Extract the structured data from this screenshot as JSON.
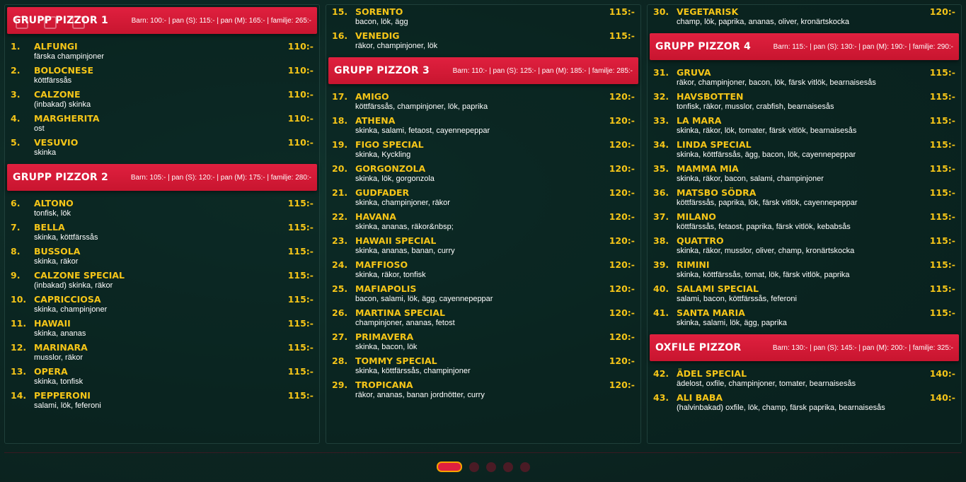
{
  "columns": [
    [
      {
        "type": "header",
        "title": "GRUPP PIZZOR 1",
        "prices": "Barn: 100:- | pan (S): 115:- | pan (M): 165:- | familje: 265:-"
      },
      {
        "type": "item",
        "num": "1.",
        "name": "ALFUNGI",
        "desc": "färska champinjoner",
        "price": "110:-"
      },
      {
        "type": "item",
        "num": "2.",
        "name": "BOLOCNESE",
        "desc": "köttfärssås",
        "price": "110:-"
      },
      {
        "type": "item",
        "num": "3.",
        "name": "CALZONE",
        "desc": "(inbakad) skinka",
        "price": "110:-"
      },
      {
        "type": "item",
        "num": "4.",
        "name": "MARGHERITA",
        "desc": "ost",
        "price": "110:-"
      },
      {
        "type": "item",
        "num": "5.",
        "name": "VESUVIO",
        "desc": "skinka",
        "price": "110:-"
      },
      {
        "type": "header",
        "title": "GRUPP PIZZOR 2",
        "prices": "Barn: 105:- | pan (S): 120:- | pan (M): 175:- | familje: 280:-"
      },
      {
        "type": "item",
        "num": "6.",
        "name": "ALTONO",
        "desc": "tonfisk, lök",
        "price": "115:-"
      },
      {
        "type": "item",
        "num": "7.",
        "name": "BELLA",
        "desc": "skinka, köttfärssås",
        "price": "115:-"
      },
      {
        "type": "item",
        "num": "8.",
        "name": "BUSSOLA",
        "desc": "skinka, räkor",
        "price": "115:-"
      },
      {
        "type": "item",
        "num": "9.",
        "name": "CALZONE SPECIAL",
        "desc": "(inbakad) skinka, räkor",
        "price": "115:-"
      },
      {
        "type": "item",
        "num": "10.",
        "name": "CAPRICCIOSA",
        "desc": "skinka, champinjoner",
        "price": "115:-"
      },
      {
        "type": "item",
        "num": "11.",
        "name": "HAWAII",
        "desc": "skinka, ananas",
        "price": "115:-"
      },
      {
        "type": "item",
        "num": "12.",
        "name": "MARINARA",
        "desc": "musslor, räkor",
        "price": "115:-"
      },
      {
        "type": "item",
        "num": "13.",
        "name": "OPERA",
        "desc": "skinka, tonfisk",
        "price": "115:-"
      },
      {
        "type": "item",
        "num": "14.",
        "name": "PEPPERONI",
        "desc": "salami, lök, feferoni",
        "price": "115:-"
      }
    ],
    [
      {
        "type": "item",
        "num": "15.",
        "name": "SORENTO",
        "desc": "bacon, lök, ägg",
        "price": "115:-"
      },
      {
        "type": "item",
        "num": "16.",
        "name": "VENEDIG",
        "desc": "räkor, champinjoner, lök",
        "price": "115:-"
      },
      {
        "type": "header",
        "title": "GRUPP PIZZOR 3",
        "prices": "Barn: 110:- | pan (S): 125:- | pan (M): 185:- | familje: 285:-"
      },
      {
        "type": "item",
        "num": "17.",
        "name": "AMIGO",
        "desc": "köttfärssås, champinjoner, lök, paprika",
        "price": "120:-"
      },
      {
        "type": "item",
        "num": "18.",
        "name": "ATHENA",
        "desc": "skinka, salami, fetaost, cayennepeppar",
        "price": "120:-"
      },
      {
        "type": "item",
        "num": "19.",
        "name": "FIGO SPECIAL",
        "desc": "skinka, Kyckling",
        "price": "120:-"
      },
      {
        "type": "item",
        "num": "20.",
        "name": "GORGONZOLA",
        "desc": "skinka, lök, gorgonzola",
        "price": "120:-"
      },
      {
        "type": "item",
        "num": "21.",
        "name": "GUDFADER",
        "desc": "skinka, champinjoner, räkor",
        "price": "120:-"
      },
      {
        "type": "item",
        "num": "22.",
        "name": "HAVANA",
        "desc": "skinka, ananas, räkor&nbsp;",
        "price": "120:-"
      },
      {
        "type": "item",
        "num": "23.",
        "name": "HAWAII SPECIAL",
        "desc": "skinka, ananas, banan, curry",
        "price": "120:-"
      },
      {
        "type": "item",
        "num": "24.",
        "name": "MAFFIOSO",
        "desc": "skinka, räkor, tonfisk",
        "price": "120:-"
      },
      {
        "type": "item",
        "num": "25.",
        "name": "MAFIAPOLIS",
        "desc": "bacon, salami, lök, ägg, cayennepeppar",
        "price": "120:-"
      },
      {
        "type": "item",
        "num": "26.",
        "name": "MARTINA SPECIAL",
        "desc": "champinjoner, ananas, fetost",
        "price": "120:-"
      },
      {
        "type": "item",
        "num": "27.",
        "name": "PRIMAVERA",
        "desc": "skinka, bacon, lök",
        "price": "120:-"
      },
      {
        "type": "item",
        "num": "28.",
        "name": "TOMMY SPECIAL",
        "desc": "skinka, köttfärssås, champinjoner",
        "price": "120:-"
      },
      {
        "type": "item",
        "num": "29.",
        "name": "TROPICANA",
        "desc": "räkor, ananas, banan jordnötter, curry",
        "price": "120:-"
      }
    ],
    [
      {
        "type": "item",
        "num": "30.",
        "name": "VEGETARISK",
        "desc": "champ, lök, paprika, ananas, oliver, kronärtskocka",
        "price": "120:-"
      },
      {
        "type": "header",
        "title": "GRUPP PIZZOR 4",
        "prices": "Barn: 115:- | pan (S): 130:- | pan (M): 190:- | familje: 290:-"
      },
      {
        "type": "item",
        "num": "31.",
        "name": "GRUVA",
        "desc": "räkor, champinjoner, bacon, lök, färsk vitlök, bearnaisesås",
        "price": "115:-"
      },
      {
        "type": "item",
        "num": "32.",
        "name": "HAVSBOTTEN",
        "desc": "tonfisk, räkor, musslor, crabfish, bearnaisesås",
        "price": "115:-"
      },
      {
        "type": "item",
        "num": "33.",
        "name": "LA MARA",
        "desc": "skinka, räkor, lök, tomater, färsk vitlök, bearnaisesås",
        "price": "115:-"
      },
      {
        "type": "item",
        "num": "34.",
        "name": "LINDA SPECIAL",
        "desc": "skinka, köttfärssås, ägg, bacon, lök, cayennepeppar",
        "price": "115:-"
      },
      {
        "type": "item",
        "num": "35.",
        "name": "MAMMA MIA",
        "desc": "skinka, räkor, bacon, salami, champinjoner",
        "price": "115:-"
      },
      {
        "type": "item",
        "num": "36.",
        "name": "MATSBO SÖDRA",
        "desc": "köttfärssås, paprika, lök, färsk vitlök, cayennepeppar",
        "price": "115:-"
      },
      {
        "type": "item",
        "num": "37.",
        "name": "MILANO",
        "desc": "köttfärssås, fetaost, paprika, färsk vitlök, kebabsås",
        "price": "115:-"
      },
      {
        "type": "item",
        "num": "38.",
        "name": "QUATTRO",
        "desc": "skinka, räkor, musslor, oliver, champ, kronärtskocka",
        "price": "115:-"
      },
      {
        "type": "item",
        "num": "39.",
        "name": "RIMINI",
        "desc": "skinka, köttfärssås, tomat, lök, färsk vitlök, paprika",
        "price": "115:-"
      },
      {
        "type": "item",
        "num": "40.",
        "name": "SALAMI SPECIAL",
        "desc": "salami, bacon, köttfärssås, feferoni",
        "price": "115:-"
      },
      {
        "type": "item",
        "num": "41.",
        "name": "SANTA MARIA",
        "desc": "skinka, salami, lök, ägg, paprika",
        "price": "115:-"
      },
      {
        "type": "header",
        "title": "OXFILE PIZZOR",
        "prices": "Barn: 130:- | pan (S): 145:- | pan (M): 200:- | familje: 325:-"
      },
      {
        "type": "item",
        "num": "42.",
        "name": "ÄDEL SPECIAL",
        "desc": "ädelost, oxfile, champinjoner, tomater, bearnaisesås",
        "price": "140:-"
      },
      {
        "type": "item",
        "num": "43.",
        "name": "ALI BABA",
        "desc": "(halvinbakad) oxfile, lök, champ, färsk paprika, bearnaisesås",
        "price": "140:-"
      }
    ]
  ],
  "pager": {
    "count": 5,
    "active": 0
  },
  "colors": {
    "accent": "#e0203f",
    "gold": "#f5c518",
    "background": "#0b2421"
  }
}
